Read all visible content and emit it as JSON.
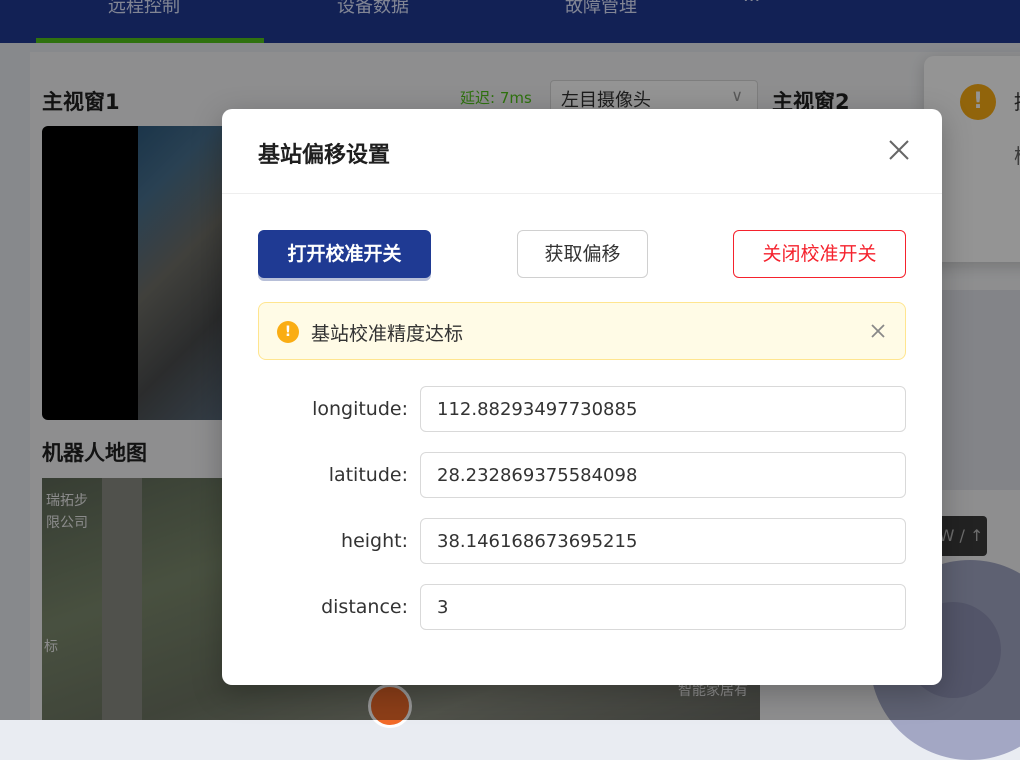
{
  "nav": {
    "tabs": [
      "远程控制",
      "设备数据",
      "故障管理"
    ],
    "more": "···",
    "active_color": "#52c41a"
  },
  "background": {
    "main_view_1": "主视窗1",
    "main_view_2": "主视窗2",
    "robot_map": "机器人地图",
    "latency": "延迟: 7ms",
    "camera_select": "左目摄像头",
    "map_labels": [
      "瑞拓步",
      "限公司",
      "标",
      "智能家居有"
    ],
    "direction_button": "W / ↑"
  },
  "notification": {
    "title": "提",
    "body": "检"
  },
  "modal": {
    "title": "基站偏移设置",
    "buttons": {
      "open_calibration": "打开校准开关",
      "get_offset": "获取偏移",
      "close_calibration": "关闭校准开关"
    },
    "alert": {
      "type": "warning",
      "message": "基站校准精度达标"
    },
    "fields": [
      {
        "label": "longitude",
        "value": "112.88293497730885"
      },
      {
        "label": "latitude",
        "value": "28.232869375584098"
      },
      {
        "label": "height",
        "value": "38.146168673695215"
      },
      {
        "label": "distance",
        "value": "3"
      }
    ],
    "label_suffix": ":"
  },
  "colors": {
    "primary": "#1f3a93",
    "danger": "#f5222d",
    "warning": "#faad14"
  }
}
